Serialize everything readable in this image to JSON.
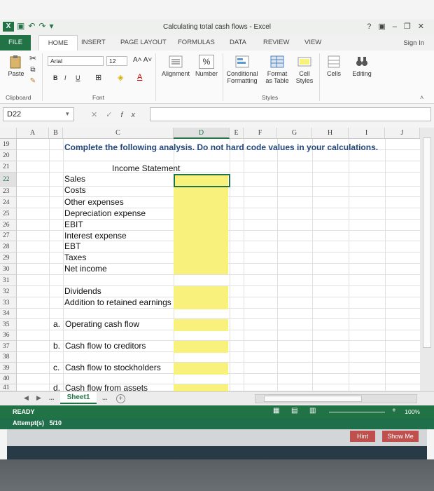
{
  "window": {
    "title": "Calculating total cash flows - Excel",
    "help": "?",
    "signin": "Sign In"
  },
  "tabs": [
    "FILE",
    "HOME",
    "INSERT",
    "PAGE LAYOUT",
    "FORMULAS",
    "DATA",
    "REVIEW",
    "VIEW"
  ],
  "ribbon": {
    "paste": "Paste",
    "font_name": "Arial",
    "font_size": "12",
    "bold": "B",
    "italic": "I",
    "underline": "U",
    "alignment": "Alignment",
    "number": "Number",
    "percent": "%",
    "conditional": "Conditional Formatting",
    "format_table": "Format as Table",
    "cell_styles": "Cell Styles",
    "cells": "Cells",
    "editing": "Editing",
    "clipboard_label": "Clipboard",
    "font_label": "Font",
    "styles_label": "Styles"
  },
  "formula_bar": {
    "name_box": "D22",
    "fx": "fx",
    "formula": ""
  },
  "columns": [
    "A",
    "B",
    "C",
    "D",
    "E",
    "F",
    "G",
    "H",
    "I",
    "J"
  ],
  "rows": [
    "19",
    "20",
    "21",
    "22",
    "23",
    "24",
    "25",
    "26",
    "27",
    "28",
    "29",
    "30",
    "31",
    "32",
    "33",
    "34",
    "35",
    "36",
    "37",
    "38",
    "39",
    "40",
    "41"
  ],
  "sheet": {
    "instruction": "Complete the following analysis. Do not hard code values in your calculations.",
    "income_statement_title": "Income Statement",
    "income_items": [
      "Sales",
      "Costs",
      "Other expenses",
      "Depreciation expense",
      "EBIT",
      "Interest expense",
      "EBT",
      "Taxes",
      "Net income"
    ],
    "dividends": "Dividends",
    "retained": "Addition to retained earnings",
    "questions": [
      {
        "letter": "a.",
        "label": "Operating cash flow"
      },
      {
        "letter": "b.",
        "label": "Cash flow to creditors"
      },
      {
        "letter": "c.",
        "label": "Cash flow to stockholders"
      },
      {
        "letter": "d.",
        "label": "Cash flow from assets"
      }
    ],
    "fill_color": "#f8f27d"
  },
  "sheet_tabs": {
    "ellipsis": "...",
    "active": "Sheet1",
    "ellipsis_right": "...",
    "add": "+"
  },
  "status": {
    "ready": "READY",
    "zoom": "100%"
  },
  "attempt": {
    "label": "Attempt(s)",
    "value": "5/10"
  },
  "buttons": {
    "hint": "Hint",
    "show_me": "Show Me"
  },
  "colors": {
    "excel_green": "#217346",
    "instruction_blue": "#24477a",
    "hint_red": "#c0504d"
  }
}
